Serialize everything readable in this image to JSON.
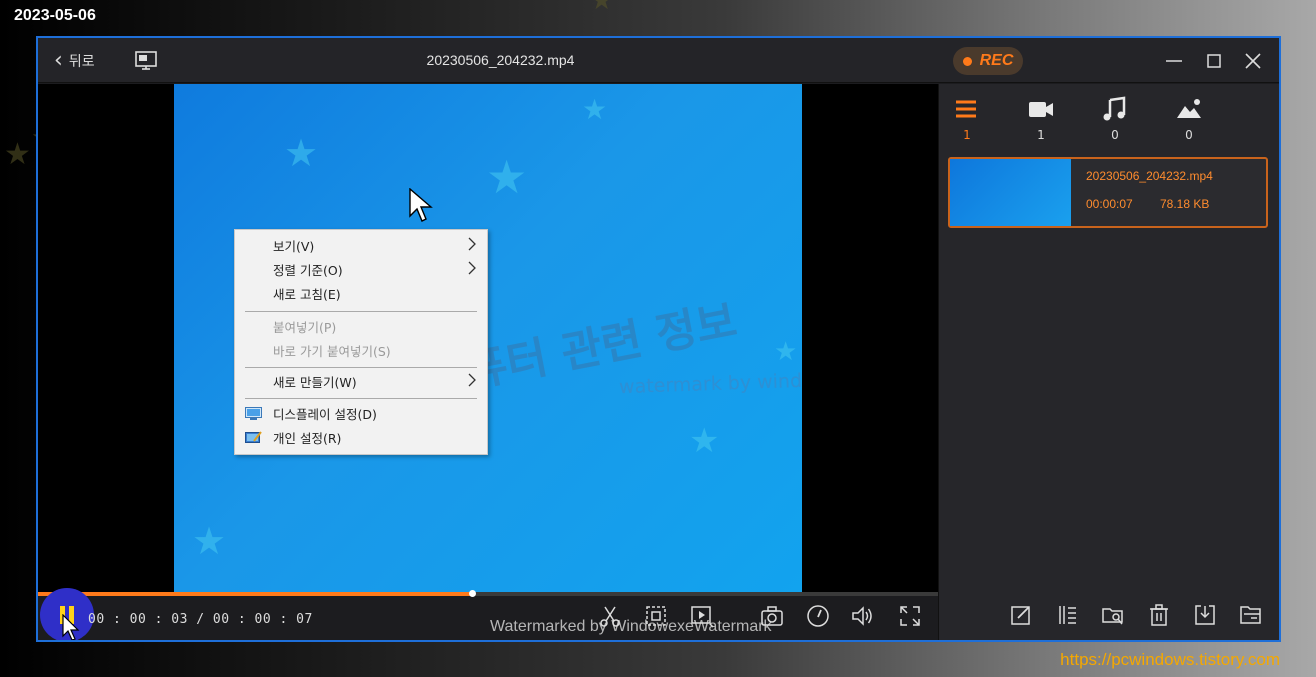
{
  "overlay": {
    "date": "2023-05-06",
    "site_url": "https://pcwindows.tistory.com"
  },
  "titlebar": {
    "back_label": "뒤로",
    "title": "20230506_204232.mp4",
    "rec_label": "REC"
  },
  "video": {
    "context_menu": {
      "items": [
        {
          "label": "보기(V)",
          "has_submenu": true,
          "disabled": false
        },
        {
          "label": "정렬 기준(O)",
          "has_submenu": true,
          "disabled": false
        },
        {
          "label": "새로 고침(E)",
          "has_submenu": false,
          "disabled": false
        },
        {
          "label": "붙여넣기(P)",
          "has_submenu": false,
          "disabled": true
        },
        {
          "label": "바로 가기 붙여넣기(S)",
          "has_submenu": false,
          "disabled": true
        },
        {
          "label": "새로 만들기(W)",
          "has_submenu": true,
          "disabled": false
        },
        {
          "label": "디스플레이 설정(D)",
          "has_submenu": false,
          "disabled": false,
          "icon": "display-settings-icon"
        },
        {
          "label": "개인 설정(R)",
          "has_submenu": false,
          "disabled": false,
          "icon": "personalize-icon"
        }
      ]
    },
    "watermark_korean": "컴퓨터 관련 정보",
    "watermark_english": "watermark by windowexe"
  },
  "player": {
    "current_time": "00 : 00 : 03",
    "separator": "/",
    "total_time": "00 : 00 : 07",
    "progress_fraction": 0.482,
    "bottom_watermark": "Watermarked by WindowexeWatermark",
    "icons": [
      "scissors-icon",
      "crop-icon",
      "preview-icon",
      "camera-icon",
      "speed-icon",
      "volume-icon",
      "fullscreen-icon"
    ]
  },
  "side_panel": {
    "tabs": [
      {
        "name": "all-files",
        "icon": "list-icon",
        "count": "1"
      },
      {
        "name": "video",
        "icon": "video-icon",
        "count": "1"
      },
      {
        "name": "audio",
        "icon": "music-icon",
        "count": "0"
      },
      {
        "name": "image",
        "icon": "image-icon",
        "count": "0"
      }
    ],
    "file": {
      "name": "20230506_204232.mp4",
      "duration": "00:00:07",
      "size": "78.18 KB"
    },
    "tools": [
      "edit-icon",
      "trim-icon",
      "search-folder-icon",
      "delete-icon",
      "export-icon",
      "open-folder-icon"
    ]
  },
  "colors": {
    "accent": "#ff7a1a",
    "window_border": "#1e6fd9",
    "date_text": "#ffffff",
    "url_text": "#f5a800"
  }
}
